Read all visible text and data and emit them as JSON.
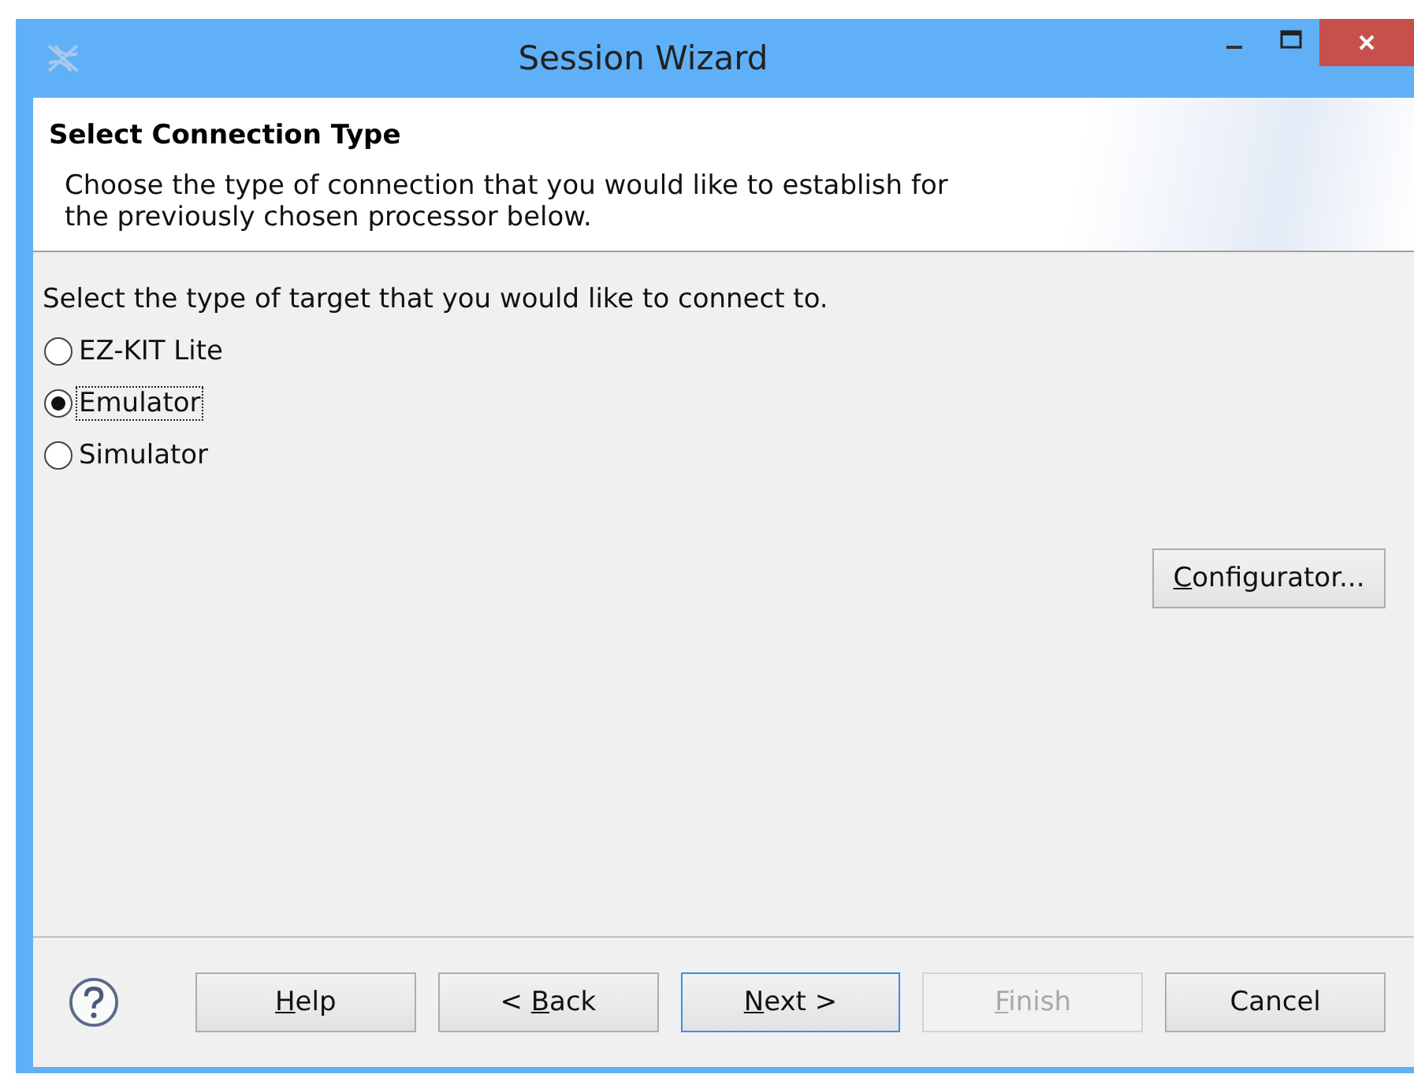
{
  "window": {
    "title": "Session Wizard"
  },
  "header": {
    "title": "Select Connection Type",
    "description": "Choose the type of connection that you would like to establish for\nthe previously chosen processor below."
  },
  "prompt": "Select the type of target that you would like to connect to.",
  "options": [
    {
      "label": "EZ-KIT Lite",
      "selected": false,
      "focused": false
    },
    {
      "label": "Emulator",
      "selected": true,
      "focused": true
    },
    {
      "label": "Simulator",
      "selected": false,
      "focused": false
    }
  ],
  "configurator_button": {
    "key": "C",
    "rest": "onfigurator..."
  },
  "buttons": [
    {
      "key": "H",
      "rest": "elp",
      "disabled": false,
      "default": false
    },
    {
      "prefix": "< ",
      "key": "B",
      "rest": "ack",
      "disabled": false,
      "default": false
    },
    {
      "key": "N",
      "rest": "ext >",
      "disabled": false,
      "default": true
    },
    {
      "key": "F",
      "rest": "inish",
      "disabled": true,
      "default": false
    },
    {
      "rest": "Cancel",
      "disabled": false,
      "default": false
    }
  ]
}
